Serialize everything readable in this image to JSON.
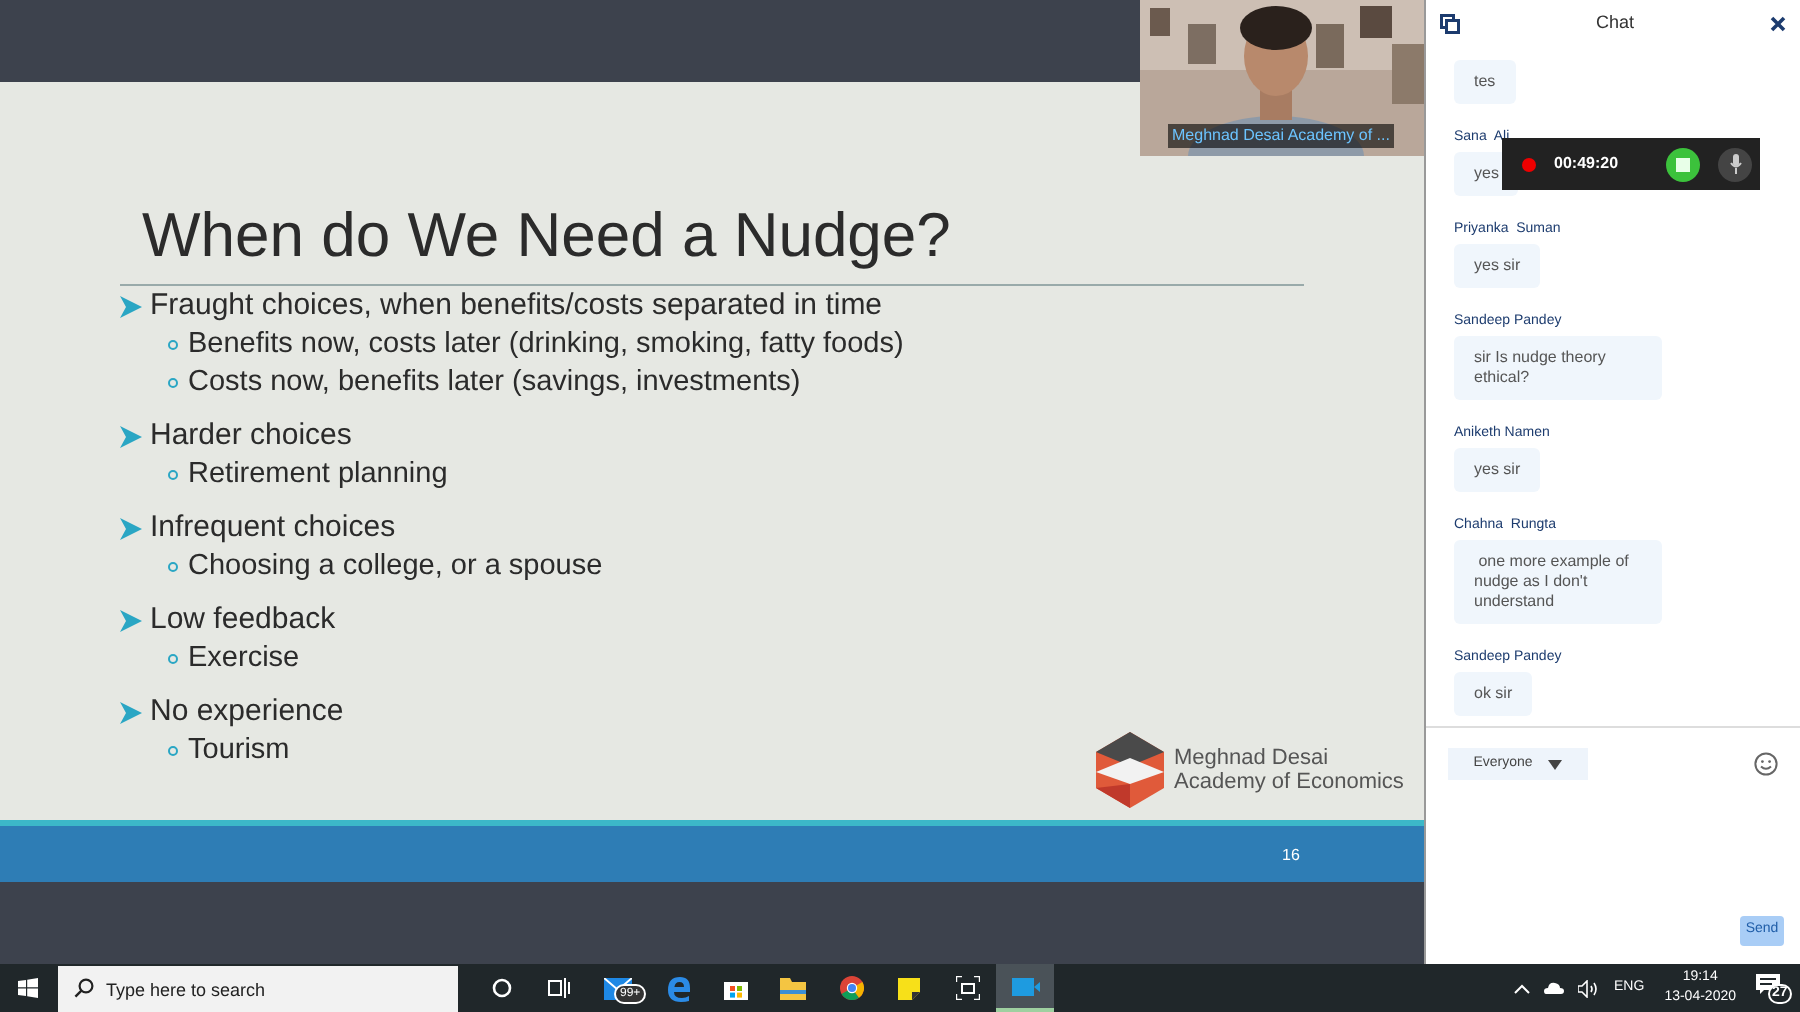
{
  "slide": {
    "title": "When do We Need a Nudge?",
    "bullets": [
      {
        "text": "Fraught choices, when benefits/costs separated in time",
        "children": [
          {
            "text": "Benefits now, costs later (drinking, smoking, fatty foods)"
          },
          {
            "text": "Costs now, benefits later (savings, investments)"
          }
        ]
      },
      {
        "text": "Harder choices",
        "children": [
          {
            "text": "Retirement planning"
          }
        ]
      },
      {
        "text": "Infrequent choices",
        "children": [
          {
            "text": "Choosing a college, or a spouse"
          }
        ]
      },
      {
        "text": "Low feedback",
        "children": [
          {
            "text": "Exercise"
          }
        ]
      },
      {
        "text": "No experience",
        "children": [
          {
            "text": "Tourism"
          }
        ]
      }
    ],
    "logo_lines": [
      "Meghnad Desai",
      "Academy of Economics"
    ],
    "page_number": "16"
  },
  "video": {
    "caption": "Meghnad Desai Academy of ..."
  },
  "recording": {
    "time": "00:49:20"
  },
  "chat": {
    "title": "Chat",
    "messages": [
      {
        "text": "tes"
      },
      {
        "sender": "Sana  Ali",
        "text": "yes"
      },
      {
        "sender": "Priyanka  Suman",
        "text": "yes sir"
      },
      {
        "sender": "Sandeep Pandey",
        "text": "sir Is nudge theory ethical?"
      },
      {
        "sender": "Aniketh Namen",
        "text": "yes sir"
      },
      {
        "sender": "Chahna  Rungta",
        "text": " one more example of nudge as I don't understand"
      },
      {
        "sender": "Sandeep Pandey",
        "text": "ok sir"
      }
    ],
    "recipient": "Everyone",
    "send_label": "Send",
    "send_disabled": true
  },
  "taskbar": {
    "search_placeholder": "Type here to search",
    "mail_badge": "99+",
    "language": "ENG",
    "time": "19:14",
    "date": "13-04-2020",
    "notification_count": "27"
  }
}
